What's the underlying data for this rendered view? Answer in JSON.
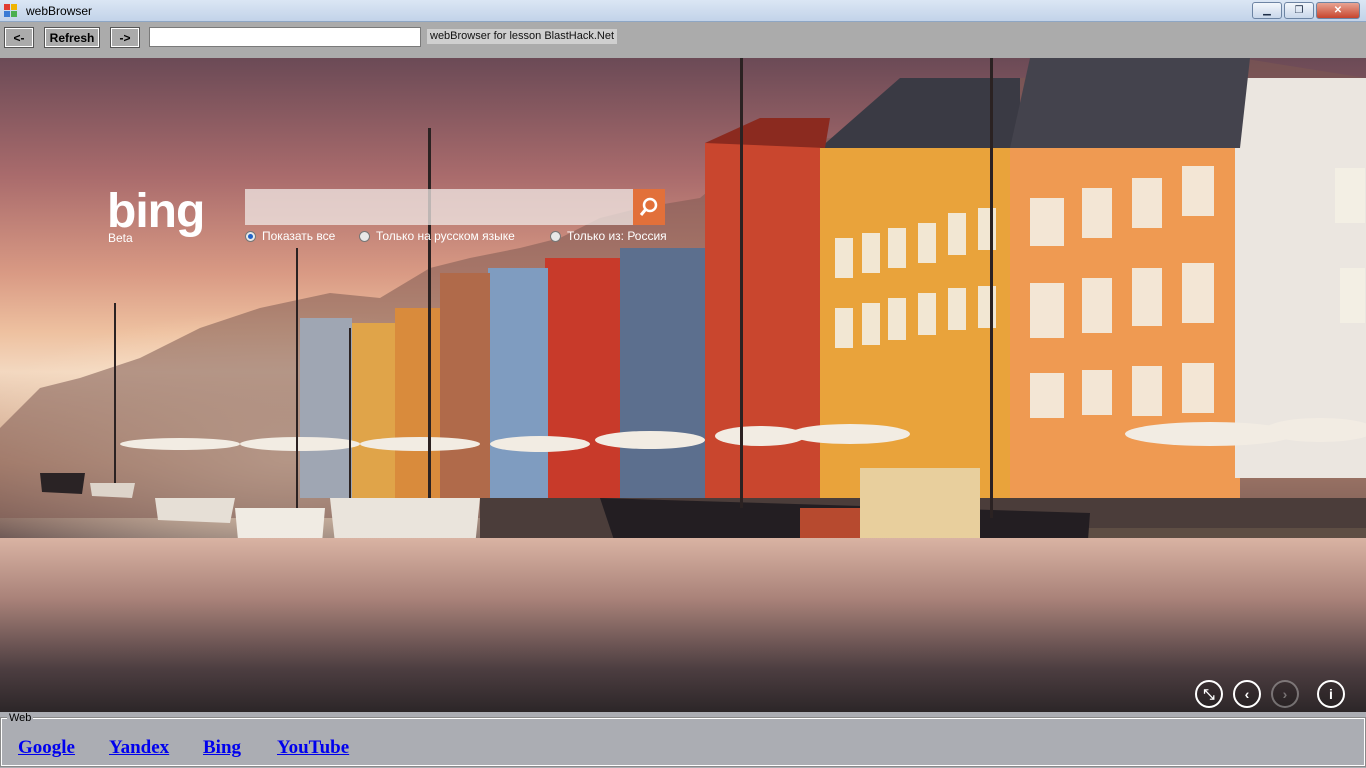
{
  "window": {
    "title": "webBrowser"
  },
  "toolbar": {
    "back_label": "<-",
    "refresh_label": "Refresh",
    "forward_label": "->",
    "url_value": "",
    "info_label": "webBrowser for lesson BlastHack.Net"
  },
  "bing": {
    "logo": "bing",
    "beta": "Beta",
    "search_placeholder": "",
    "options": [
      {
        "label": "Показать все",
        "selected": true
      },
      {
        "label": "Только на русском языке",
        "selected": false
      },
      {
        "label": "Только из: Россия",
        "selected": false
      }
    ],
    "accent_color": "#e2703a"
  },
  "group": {
    "title": "Web",
    "links": [
      {
        "label": "Google"
      },
      {
        "label": "Yandex"
      },
      {
        "label": "Bing"
      },
      {
        "label": "YouTube"
      }
    ]
  }
}
